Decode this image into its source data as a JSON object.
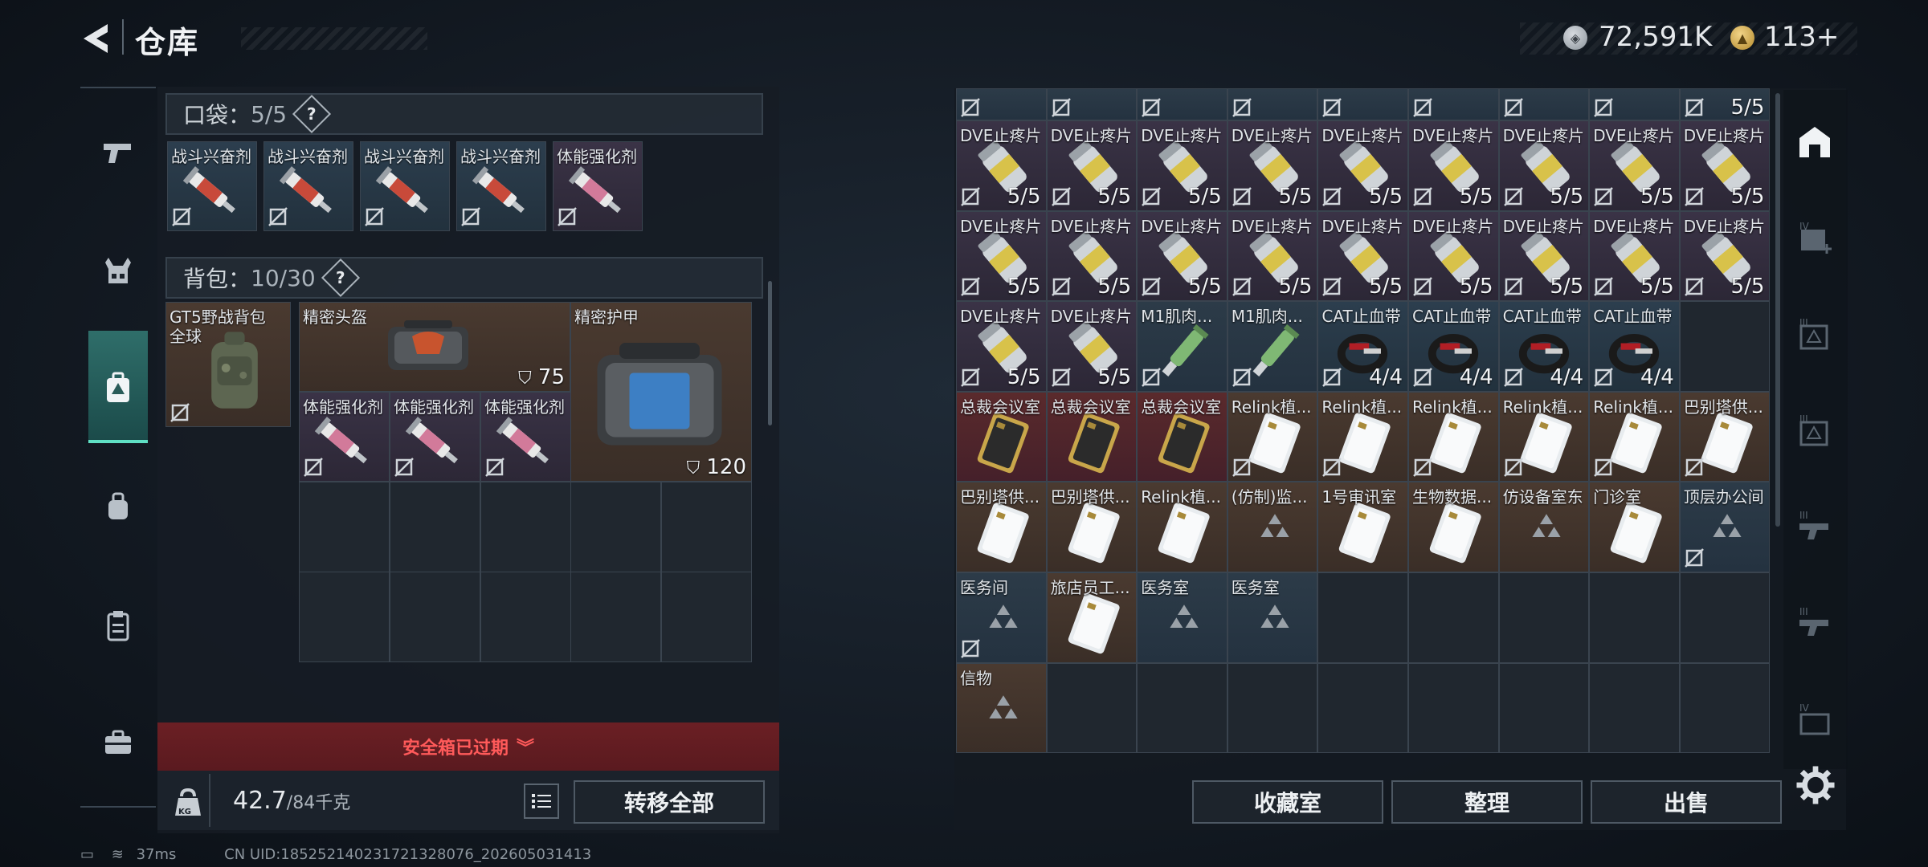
{
  "header": {
    "title": "仓库",
    "currency": {
      "coins": "72,591K",
      "gold": "113+"
    }
  },
  "sidebar": {
    "items": [
      {
        "name": "weapons",
        "icon": "pistol-icon"
      },
      {
        "name": "armor",
        "icon": "vest-icon"
      },
      {
        "name": "inventory",
        "icon": "backpack-medical-icon",
        "active": true
      },
      {
        "name": "bag",
        "icon": "bag-icon"
      },
      {
        "name": "clipboard",
        "icon": "clipboard-icon"
      },
      {
        "name": "case",
        "icon": "briefcase-icon"
      }
    ]
  },
  "pocket": {
    "label": "口袋：",
    "count": "5/5",
    "help": "?",
    "items": [
      "战斗兴奋剂",
      "战斗兴奋剂",
      "战斗兴奋剂",
      "战斗兴奋剂",
      "体能强化剂"
    ]
  },
  "backpack": {
    "label": "背包：",
    "count": "10/30",
    "help": "?",
    "bag_name": "GT5野战背包",
    "bag_sub": "全球",
    "helmet": {
      "name": "精密头盔",
      "durability": "75"
    },
    "armor": {
      "name": "精密护甲",
      "durability": "120"
    },
    "items": [
      "体能强化剂",
      "体能强化剂",
      "体能强化剂"
    ]
  },
  "safe_box": {
    "status": "安全箱已过期"
  },
  "weight": {
    "current": "42.7",
    "max": "/84千克",
    "icon_label": "KG"
  },
  "buttons": {
    "transfer_all": "转移全部",
    "collection": "收藏室",
    "organize": "整理",
    "sell": "出售"
  },
  "status_bar": {
    "ping": "37ms",
    "uid": "CN UID:185252140231721328076_202605031413"
  },
  "stash": {
    "row0_count": "5/5",
    "rows": [
      [
        {
          "n": "DVE止疼片",
          "c": "5/5"
        },
        {
          "n": "DVE止疼片",
          "c": "5/5"
        },
        {
          "n": "DVE止疼片",
          "c": "5/5"
        },
        {
          "n": "DVE止疼片",
          "c": "5/5"
        },
        {
          "n": "DVE止疼片",
          "c": "5/5"
        },
        {
          "n": "DVE止疼片",
          "c": "5/5"
        },
        {
          "n": "DVE止疼片",
          "c": "5/5"
        },
        {
          "n": "DVE止疼片",
          "c": "5/5"
        },
        {
          "n": "DVE止疼片",
          "c": "5/5"
        }
      ],
      [
        {
          "n": "DVE止疼片",
          "c": "5/5"
        },
        {
          "n": "DVE止疼片",
          "c": "5/5"
        },
        {
          "n": "DVE止疼片",
          "c": "5/5"
        },
        {
          "n": "DVE止疼片",
          "c": "5/5"
        },
        {
          "n": "DVE止疼片",
          "c": "5/5"
        },
        {
          "n": "DVE止疼片",
          "c": "5/5"
        },
        {
          "n": "DVE止疼片",
          "c": "5/5"
        },
        {
          "n": "DVE止疼片",
          "c": "5/5"
        },
        {
          "n": "DVE止疼片",
          "c": "5/5"
        }
      ],
      [
        {
          "n": "DVE止疼片",
          "c": "5/5"
        },
        {
          "n": "DVE止疼片",
          "c": "5/5"
        },
        {
          "n": "M1肌肉...",
          "c": ""
        },
        {
          "n": "M1肌肉...",
          "c": ""
        },
        {
          "n": "CAT止血带",
          "c": "4/4"
        },
        {
          "n": "CAT止血带",
          "c": "4/4"
        },
        {
          "n": "CAT止血带",
          "c": "4/4"
        },
        {
          "n": "CAT止血带",
          "c": "4/4"
        }
      ],
      [
        {
          "n": "总裁会议室",
          "c": ""
        },
        {
          "n": "总裁会议室",
          "c": ""
        },
        {
          "n": "总裁会议室",
          "c": ""
        },
        {
          "n": "Relink植...",
          "c": ""
        },
        {
          "n": "Relink植...",
          "c": ""
        },
        {
          "n": "Relink植...",
          "c": ""
        },
        {
          "n": "Relink植...",
          "c": ""
        },
        {
          "n": "Relink植...",
          "c": ""
        },
        {
          "n": "巴别塔供...",
          "c": ""
        }
      ],
      [
        {
          "n": "巴别塔供...",
          "c": ""
        },
        {
          "n": "巴别塔供...",
          "c": ""
        },
        {
          "n": "Relink植...",
          "c": ""
        },
        {
          "n": "(仿制)监...",
          "c": ""
        },
        {
          "n": "1号审讯室",
          "c": ""
        },
        {
          "n": "生物数据...",
          "c": ""
        },
        {
          "n": "仿设备室东",
          "c": ""
        },
        {
          "n": "门诊室",
          "c": ""
        },
        {
          "n": "顶层办公间",
          "c": ""
        }
      ],
      [
        {
          "n": "医务间",
          "c": ""
        },
        {
          "n": "旅店员工...",
          "c": ""
        },
        {
          "n": "医务室",
          "c": ""
        },
        {
          "n": "医务室",
          "c": ""
        }
      ],
      [
        {
          "n": "信物",
          "c": ""
        }
      ]
    ]
  }
}
